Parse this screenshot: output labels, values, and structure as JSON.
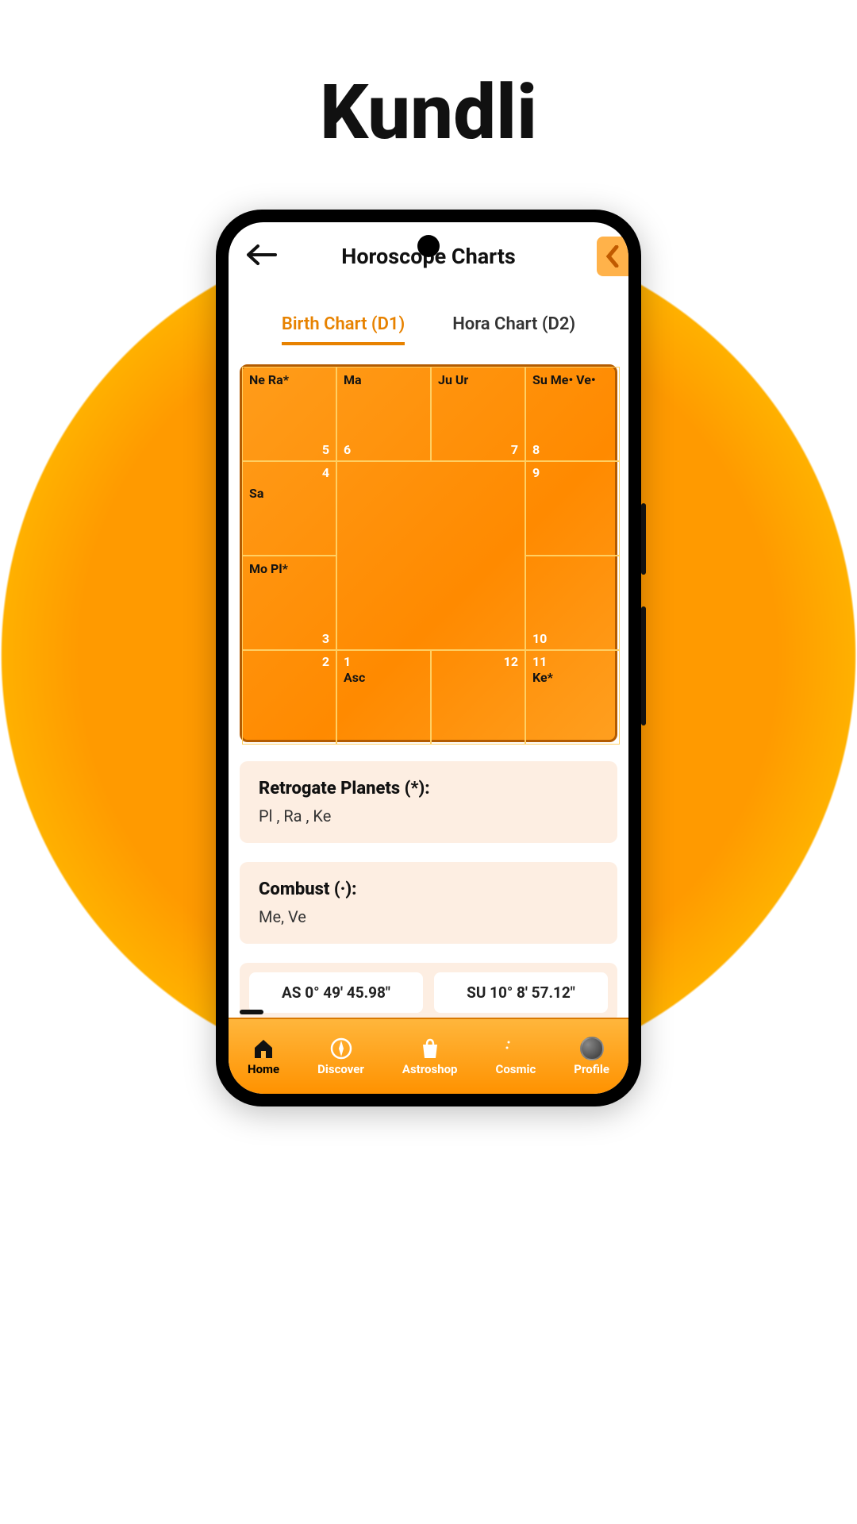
{
  "page": {
    "title": "Kundli"
  },
  "header": {
    "title": "Horoscope Charts"
  },
  "tabs": [
    {
      "label": "Birth Chart (D1)",
      "active": true
    },
    {
      "label": "Hora Chart (D2)",
      "active": false
    }
  ],
  "chart": {
    "type": "south-indian",
    "houses": {
      "1": {
        "num": "1",
        "planets": "Asc"
      },
      "2": {
        "num": "2",
        "planets": ""
      },
      "3": {
        "num": "3",
        "planets": "Mo Pl*"
      },
      "4": {
        "num": "4",
        "planets": "Sa"
      },
      "5": {
        "num": "5",
        "planets": "Ne Ra*"
      },
      "6": {
        "num": "6",
        "planets": "Ma"
      },
      "7": {
        "num": "7",
        "planets": "Ju Ur"
      },
      "8": {
        "num": "8",
        "planets": "Su Me• Ve•"
      },
      "9": {
        "num": "9",
        "planets": ""
      },
      "10": {
        "num": "10",
        "planets": ""
      },
      "11": {
        "num": "11",
        "planets": "Ke*"
      },
      "12": {
        "num": "12",
        "planets": ""
      }
    }
  },
  "retro": {
    "title": "Retrogate Planets (*):",
    "value": "Pl , Ra , Ke"
  },
  "combust": {
    "title": "Combust (·):",
    "value": "Me, Ve"
  },
  "positions": {
    "as": "AS 0° 49' 45.98\"",
    "su": "SU 10° 8' 57.12\""
  },
  "nav": {
    "home": "Home",
    "discover": "Discover",
    "astroshop": "Astroshop",
    "cosmic": "Cosmic",
    "profile": "Profile"
  }
}
